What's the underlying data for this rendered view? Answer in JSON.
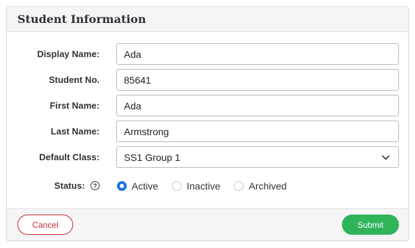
{
  "header": {
    "title": "Student Information"
  },
  "form": {
    "display_name": {
      "label": "Display Name:",
      "value": "Ada"
    },
    "student_no": {
      "label": "Student No.",
      "value": "85641"
    },
    "first_name": {
      "label": "First Name:",
      "value": "Ada"
    },
    "last_name": {
      "label": "Last Name:",
      "value": "Armstrong"
    },
    "default_class": {
      "label": "Default Class:",
      "value": "SS1 Group 1"
    },
    "status": {
      "label": "Status:",
      "help_icon": "question-circle-icon",
      "options": [
        "Active",
        "Inactive",
        "Archived"
      ],
      "selected": "Active"
    }
  },
  "footer": {
    "cancel_label": "Cancel",
    "submit_label": "Submit"
  },
  "colors": {
    "accent": "#1f74d6",
    "cancel": "#c62b36",
    "submit": "#2fb45a"
  }
}
